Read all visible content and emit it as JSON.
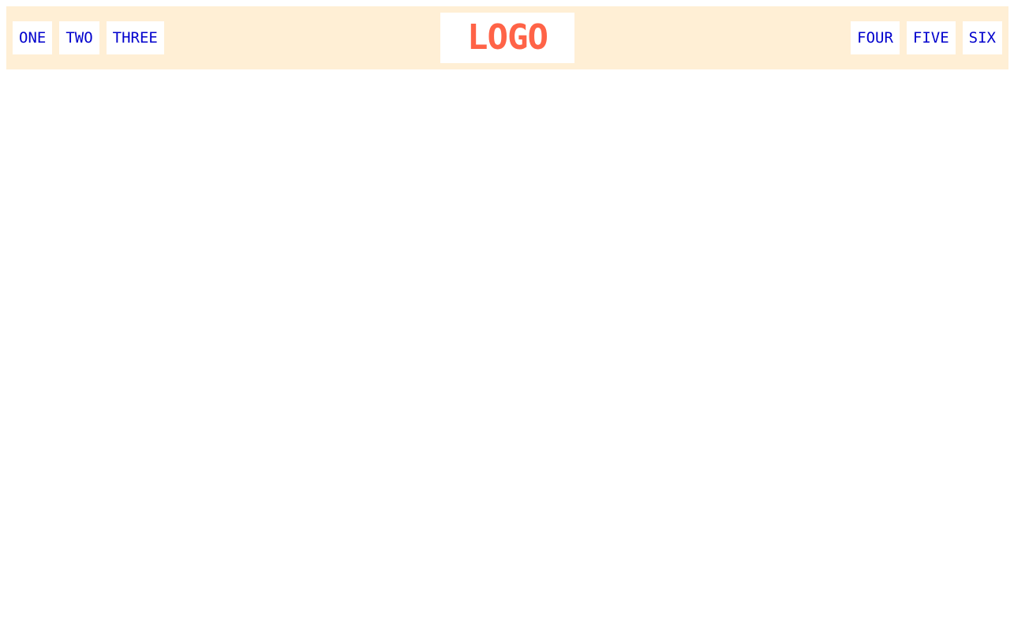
{
  "colors": {
    "navbar_background": "#ffefd5",
    "link_text": "#0000cd",
    "link_background": "#ffffff",
    "logo_text": "#ff6347",
    "page_background": "#ffffff"
  },
  "nav": {
    "left_items": [
      {
        "label": "ONE"
      },
      {
        "label": "TWO"
      },
      {
        "label": "THREE"
      }
    ],
    "logo": "LOGO",
    "right_items": [
      {
        "label": "FOUR"
      },
      {
        "label": "FIVE"
      },
      {
        "label": "SIX"
      }
    ]
  }
}
